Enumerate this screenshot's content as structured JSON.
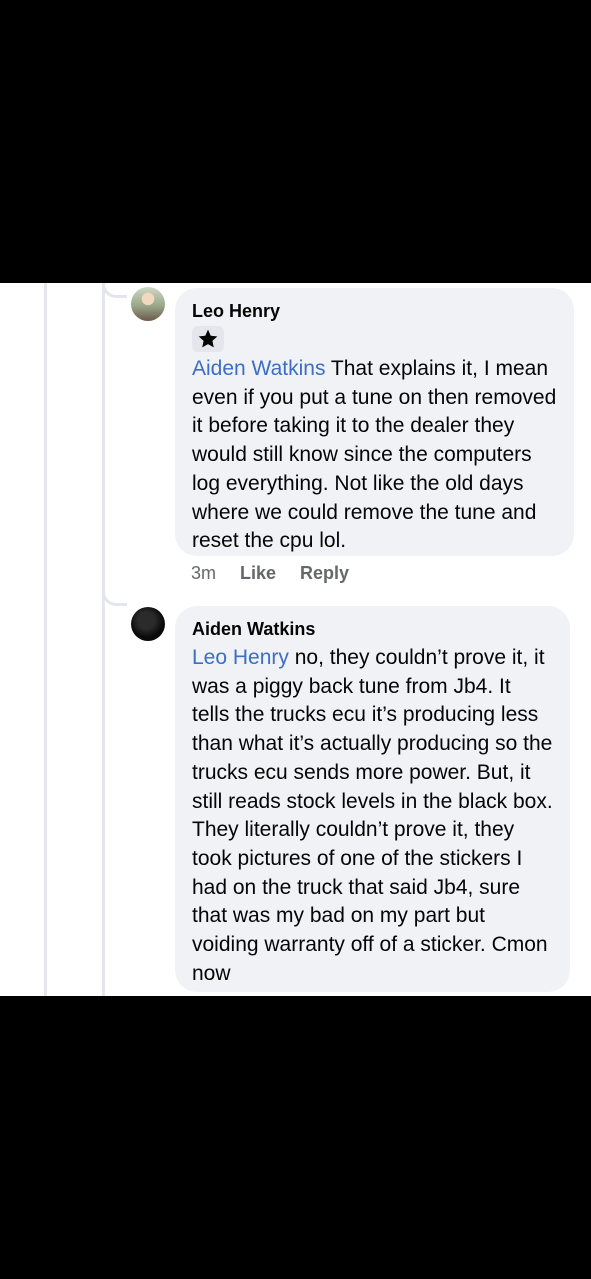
{
  "comments": [
    {
      "author": "Leo Henry",
      "badge_icon": "star-badge-icon",
      "mention": "Aiden Watkins",
      "text": " That explains it,  I mean even if you put a tune on then removed it before taking it to the dealer they would still know since the computers log everything. Not like the old days where we could remove the tune and reset the cpu lol.",
      "time": "3m",
      "like_label": "Like",
      "reply_label": "Reply"
    },
    {
      "author": "Aiden Watkins",
      "mention": "Leo Henry",
      "text": " no, they couldn’t prove it, it was a piggy back tune from Jb4. It tells the trucks ecu it’s producing less than what it’s actually producing so the trucks ecu sends more power. But, it still reads stock levels in the black box. They literally couldn’t prove it, they took pictures of one of the stickers I had on the truck that said Jb4, sure that was my bad on my part but voiding warranty off of a sticker. Cmon now"
    }
  ],
  "colors": {
    "mention": "#3b6ec4",
    "bubble": "#f0f2f5",
    "meta": "#65676b"
  }
}
